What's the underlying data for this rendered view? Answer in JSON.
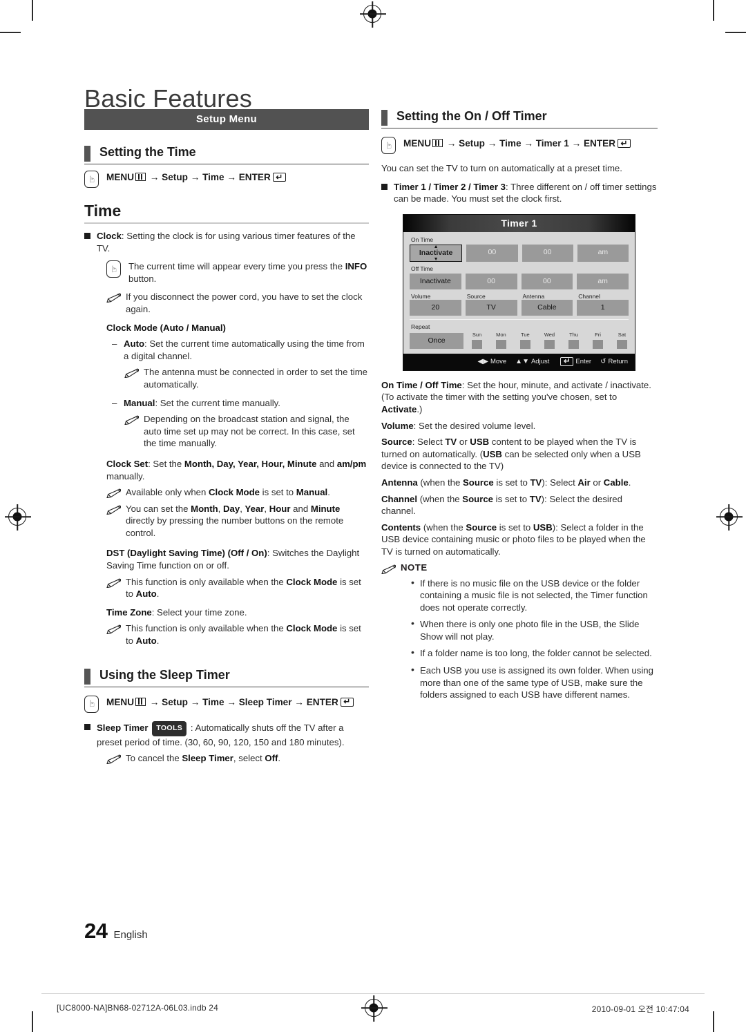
{
  "page": {
    "title": "Basic Features",
    "number": "24",
    "language": "English"
  },
  "left": {
    "band_label": "Setup Menu",
    "section1": {
      "heading": "Setting the Time",
      "menu_path": {
        "prefix": "MENU",
        "menu_glyph": "menu-icon",
        "steps": " → Setup → Time → ",
        "enter": "ENTER",
        "enter_glyph": "enter-icon"
      }
    },
    "time_heading": "Time",
    "clock_bullet": {
      "label": "Clock",
      "text": ": Setting the clock is for using various timer features of the TV."
    },
    "note_info": {
      "pre": "The current time will appear every time you press the ",
      "bold": "INFO",
      "post": " button."
    },
    "note_powercord": "If you disconnect the power cord, you have to set the clock again.",
    "clock_mode_heading": "Clock Mode (Auto / Manual)",
    "auto": {
      "label": "Auto",
      "text": ": Set the current time automatically using the time from a digital channel.",
      "note": "The antenna must be connected in order to set the time automatically."
    },
    "manual": {
      "label": "Manual",
      "text": ": Set the current time manually.",
      "note": "Depending on the broadcast station and signal, the auto time set up may not be correct. In this case, set the time manually."
    },
    "clock_set": {
      "label": "Clock Set",
      "p1": ": Set the ",
      "fields": "Month, Day, Year, Hour, Minute",
      "p2": " and ",
      "ampm": "am/pm",
      "p3": " manually.",
      "note1_a": "Available only when ",
      "note1_b": "Clock Mode",
      "note1_c": " is set to ",
      "note1_d": "Manual",
      "note1_e": ".",
      "note2_a": "You can set the ",
      "note2_months": "Month",
      "note2_sep1": ", ",
      "note2_day": "Day",
      "note2_sep2": ", ",
      "note2_year": "Year",
      "note2_sep3": ", ",
      "note2_hour": "Hour",
      "note2_and": " and ",
      "note2_minute": "Minute",
      "note2_tail": " directly by pressing the number buttons on the remote control."
    },
    "dst": {
      "label": "DST (Daylight Saving Time) (Off / On)",
      "text": ": Switches the Daylight Saving Time function on or off.",
      "note_a": "This function is only available when the ",
      "note_b": "Clock Mode",
      "note_c": " is set to ",
      "note_d": "Auto",
      "note_e": "."
    },
    "timezone": {
      "label": "Time Zone",
      "text": ": Select your time zone.",
      "note_a": "This function is only available when the ",
      "note_b": "Clock Mode",
      "note_c": " is set to ",
      "note_d": "Auto",
      "note_e": "."
    },
    "section2": {
      "heading": "Using the Sleep Timer",
      "menu_path": {
        "prefix": "MENU",
        "steps": " → Setup → Time → Sleep Timer → ",
        "enter": "ENTER"
      },
      "bullet": {
        "label": "Sleep Timer",
        "tools_badge": "TOOLS",
        "text": " : Automatically shuts off the TV after a preset period of time. (30, 60, 90, 120, 150 and 180 minutes).",
        "note_a": "To cancel the ",
        "note_b": "Sleep Timer",
        "note_c": ", select ",
        "note_d": "Off",
        "note_e": "."
      }
    }
  },
  "right": {
    "section": {
      "heading": "Setting the On / Off Timer",
      "menu_path": {
        "prefix": "MENU",
        "steps": " → Setup → Time → Timer 1 → ",
        "enter": "ENTER"
      }
    },
    "intro": "You can set the TV to turn on automatically at a preset time.",
    "timer_bullet": {
      "label": "Timer 1 / Timer 2 / Timer 3",
      "text": ": Three different on / off timer settings can be made. You must set the clock first."
    },
    "osd": {
      "title": "Timer 1",
      "on_time_label": "On Time",
      "on_time": {
        "state": "Inactivate",
        "hour": "00",
        "minute": "00",
        "ampm": "am"
      },
      "off_time_label": "Off Time",
      "off_time": {
        "state": "Inactivate",
        "hour": "00",
        "minute": "00",
        "ampm": "am"
      },
      "fields_labels": [
        "Volume",
        "Source",
        "Antenna",
        "Channel"
      ],
      "fields_values": [
        "20",
        "TV",
        "Cable",
        "1"
      ],
      "repeat_label": "Repeat",
      "repeat_value": "Once",
      "days": [
        "Sun",
        "Mon",
        "Tue",
        "Wed",
        "Thu",
        "Fri",
        "Sat"
      ],
      "footer": [
        {
          "glyph": "◀▶",
          "label": "Move"
        },
        {
          "glyph": "▲▼",
          "label": "Adjust"
        },
        {
          "glyph": "enter-icon",
          "label": "Enter"
        },
        {
          "glyph": "↺",
          "label": "Return"
        }
      ]
    },
    "defs": {
      "ontime_label": "On Time / Off Time",
      "ontime_p1": ": Set the hour, minute, and activate / inactivate. (To activate the timer with the setting you've chosen, set to ",
      "ontime_bold": "Activate",
      "ontime_p2": ".)",
      "volume_label": "Volume",
      "volume_text": ": Set the desired volume level.",
      "source_label": "Source",
      "source_p1": ": Select ",
      "source_tv": "TV",
      "source_p2": " or ",
      "source_usb": "USB",
      "source_p3": " content to be played when the TV is turned on automatically. (",
      "source_usb2": "USB",
      "source_p4": " can be selected only when a USB device is connected to the TV)",
      "antenna_label": "Antenna",
      "antenna_p1": " (when the ",
      "antenna_source": "Source",
      "antenna_p2": " is set to ",
      "antenna_tv": "TV",
      "antenna_p3": "): Select ",
      "antenna_air": "Air",
      "antenna_p4": " or ",
      "antenna_cable": "Cable",
      "antenna_p5": ".",
      "channel_label": "Channel",
      "channel_p1": " (when the ",
      "channel_source": "Source",
      "channel_p2": " is set to ",
      "channel_tv": "TV",
      "channel_p3": "): Select the desired channel.",
      "contents_label": "Contents",
      "contents_p1": " (when the ",
      "contents_source": "Source",
      "contents_p2": " is set to ",
      "contents_usb": "USB",
      "contents_p3": "): Select a folder in the USB device containing music or photo files to be played when the TV is turned on automatically."
    },
    "note_title": "NOTE",
    "notes": [
      "If there is no music file on the USB device or the folder containing a music file is not selected, the Timer function does not operate correctly.",
      "When there is only one photo file in the USB, the Slide Show will not play.",
      "If a folder name is too long, the folder cannot be selected.",
      "Each USB you use is assigned its own folder. When using more than one of the same type of USB, make sure the folders assigned to each USB have different names."
    ]
  },
  "footer": {
    "left": "[UC8000-NA]BN68-02712A-06L03.indb   24",
    "right": "2010-09-01   오전 10:47:04"
  },
  "colors": {
    "band": "#525252",
    "heading_bar": "#555555",
    "osd_bg": "#d7d7d7",
    "osd_cell": "#9a9a9a",
    "osd_footer": "#0a0a0a"
  }
}
